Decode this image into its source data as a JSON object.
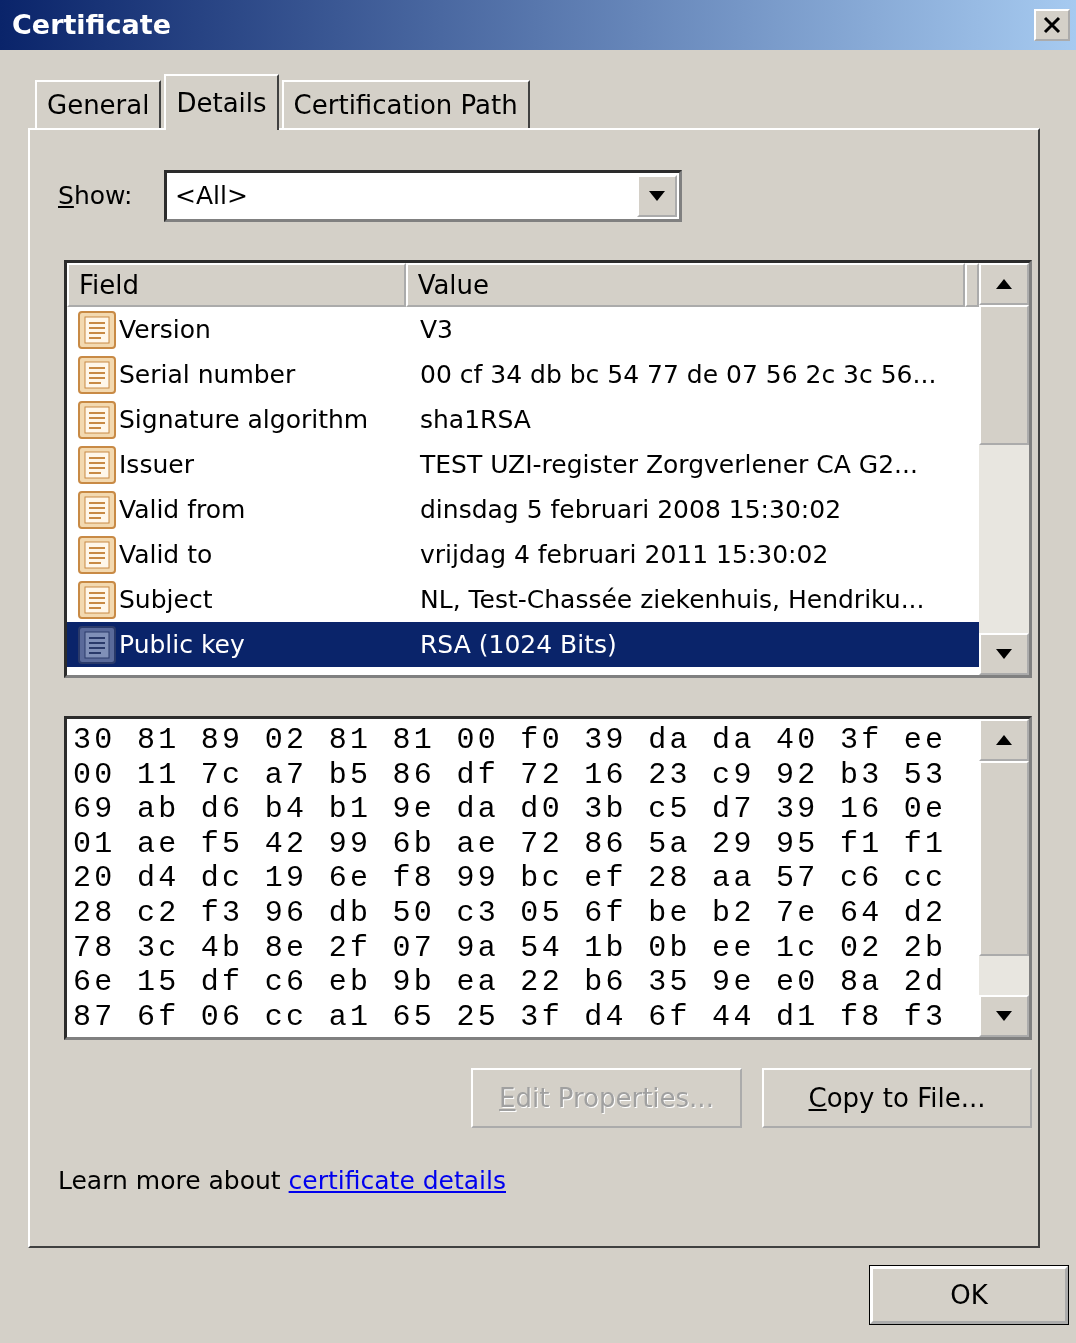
{
  "window": {
    "title": "Certificate"
  },
  "tabs": [
    {
      "label": "General",
      "selected": false
    },
    {
      "label": "Details",
      "selected": true
    },
    {
      "label": "Certification Path",
      "selected": false
    }
  ],
  "show": {
    "label": "Show:",
    "value": "<All>"
  },
  "fields_table": {
    "columns": [
      "Field",
      "Value"
    ],
    "rows": [
      {
        "field": "Version",
        "value": "V3",
        "selected": false
      },
      {
        "field": "Serial number",
        "value": "00 cf 34 db bc 54 77 de 07 56 2c 3c 56...",
        "selected": false
      },
      {
        "field": "Signature algorithm",
        "value": "sha1RSA",
        "selected": false
      },
      {
        "field": "Issuer",
        "value": "TEST UZI-register Zorgverlener CA G2...",
        "selected": false
      },
      {
        "field": "Valid from",
        "value": "dinsdag 5 februari 2008 15:30:02",
        "selected": false
      },
      {
        "field": "Valid to",
        "value": "vrijdag 4 februari 2011 15:30:02",
        "selected": false
      },
      {
        "field": "Subject",
        "value": "NL, Test-Chassée ziekenhuis, Hendriku...",
        "selected": false
      },
      {
        "field": "Public key",
        "value": "RSA (1024 Bits)",
        "selected": true
      }
    ]
  },
  "value_lines": [
    "30 81 89 02 81 81 00 f0 39 da da 40 3f ee",
    "00 11 7c a7 b5 86 df 72 16 23 c9 92 b3 53",
    "69 ab d6 b4 b1 9e da d0 3b c5 d7 39 16 0e",
    "01 ae f5 42 99 6b ae 72 86 5a 29 95 f1 f1",
    "20 d4 dc 19 6e f8 99 bc ef 28 aa 57 c6 cc",
    "28 c2 f3 96 db 50 c3 05 6f be b2 7e 64 d2",
    "78 3c 4b 8e 2f 07 9a 54 1b 0b ee 1c 02 2b",
    "6e 15 df c6 eb 9b ea 22 b6 35 9e e0 8a 2d",
    "87 6f 06 cc a1 65 25 3f d4 6f 44 d1 f8 f3"
  ],
  "buttons": [
    {
      "label": "Edit Properties...",
      "disabled": true
    },
    {
      "label": "Copy to File...",
      "disabled": false
    }
  ],
  "learn_more": {
    "text": "Learn more about",
    "link": "certificate details"
  },
  "ok_button": {
    "label": "OK"
  }
}
